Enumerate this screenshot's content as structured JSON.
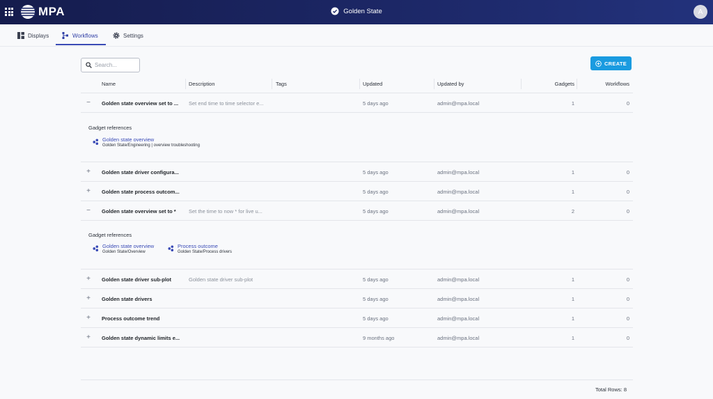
{
  "header": {
    "logo_text": "MPA",
    "title": "Golden State",
    "avatar_initial": "A"
  },
  "tabs": [
    {
      "label": "Displays",
      "icon": "dashboard-icon",
      "active": false
    },
    {
      "label": "Workflows",
      "icon": "workflow-icon",
      "active": true
    },
    {
      "label": "Settings",
      "icon": "gear-icon",
      "active": false
    }
  ],
  "search": {
    "placeholder": "Search...",
    "value": ""
  },
  "create_label": "CREATE",
  "columns": [
    "Name",
    "Description",
    "Tags",
    "Updated",
    "Updated by",
    "Gadgets",
    "Workflows"
  ],
  "rows": [
    {
      "expanded": true,
      "name": "Golden state overview set to ...",
      "description": "Set end time to time selector e...",
      "tags": "",
      "updated": "5 days ago",
      "updated_by": "admin@mpa.local",
      "gadgets": "1",
      "workflows": "0",
      "refs_title": "Gadget references",
      "refs": [
        {
          "link": "Golden state overview",
          "sub": "Golden State/Engineering | overview troubleshooting"
        }
      ]
    },
    {
      "expanded": false,
      "name": "Golden state driver configura...",
      "description": "",
      "tags": "",
      "updated": "5 days ago",
      "updated_by": "admin@mpa.local",
      "gadgets": "1",
      "workflows": "0"
    },
    {
      "expanded": false,
      "name": "Golden state process outcom...",
      "description": "",
      "tags": "",
      "updated": "5 days ago",
      "updated_by": "admin@mpa.local",
      "gadgets": "1",
      "workflows": "0"
    },
    {
      "expanded": true,
      "name": "Golden state overview set to *",
      "description": "Set the time to now * for live u...",
      "tags": "",
      "updated": "5 days ago",
      "updated_by": "admin@mpa.local",
      "gadgets": "2",
      "workflows": "0",
      "refs_title": "Gadget references",
      "refs": [
        {
          "link": "Golden state overview",
          "sub": "Golden State/Overview"
        },
        {
          "link": "Process outcome",
          "sub": "Golden State/Process drivers"
        }
      ]
    },
    {
      "expanded": false,
      "name": "Golden state driver sub-plot",
      "description": "Golden state driver sub-plot",
      "tags": "",
      "updated": "5 days ago",
      "updated_by": "admin@mpa.local",
      "gadgets": "1",
      "workflows": "0"
    },
    {
      "expanded": false,
      "name": "Golden state drivers",
      "description": "",
      "tags": "",
      "updated": "5 days ago",
      "updated_by": "admin@mpa.local",
      "gadgets": "1",
      "workflows": "0"
    },
    {
      "expanded": false,
      "name": "Process outcome trend",
      "description": "",
      "tags": "",
      "updated": "5 days ago",
      "updated_by": "admin@mpa.local",
      "gadgets": "1",
      "workflows": "0"
    },
    {
      "expanded": false,
      "name": "Golden state dynamic limits e...",
      "description": "",
      "tags": "",
      "updated": "9 months ago",
      "updated_by": "admin@mpa.local",
      "gadgets": "1",
      "workflows": "0"
    }
  ],
  "footer": {
    "total_rows": "Total Rows: 8"
  },
  "colors": {
    "accent": "#3a4bb6",
    "create_button": "#1a9be0",
    "header_bg": "#1c2766"
  }
}
